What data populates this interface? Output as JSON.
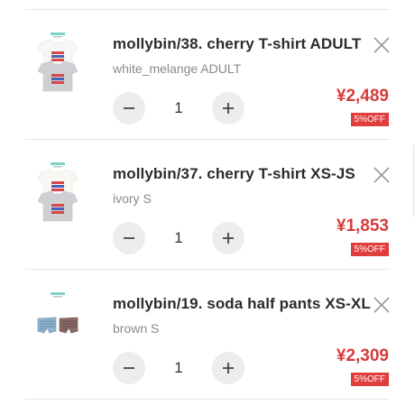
{
  "cart": {
    "items": [
      {
        "name": "mollybin/38. cherry T-shirt ADULT",
        "variant": "white_melange ADULT",
        "quantity": "1",
        "price": "¥2,489",
        "discount_badge": "5%OFF",
        "thumbnail_icon": "tshirt-product-image"
      },
      {
        "name": "mollybin/37. cherry T-shirt XS-JS",
        "variant": "ivory S",
        "quantity": "1",
        "price": "¥1,853",
        "discount_badge": "5%OFF",
        "thumbnail_icon": "tshirt-product-image"
      },
      {
        "name": "mollybin/19. soda half pants XS-XL",
        "variant": "brown S",
        "quantity": "1",
        "price": "¥2,309",
        "discount_badge": "5%OFF",
        "thumbnail_icon": "shorts-product-image"
      }
    ],
    "icons": {
      "remove": "close-icon",
      "decrease": "minus-icon",
      "increase": "plus-icon"
    },
    "colors": {
      "price": "#d63c3c",
      "badge_bg": "#e03d3d",
      "button_bg": "#ededed",
      "divider": "#e6e6e6"
    }
  }
}
